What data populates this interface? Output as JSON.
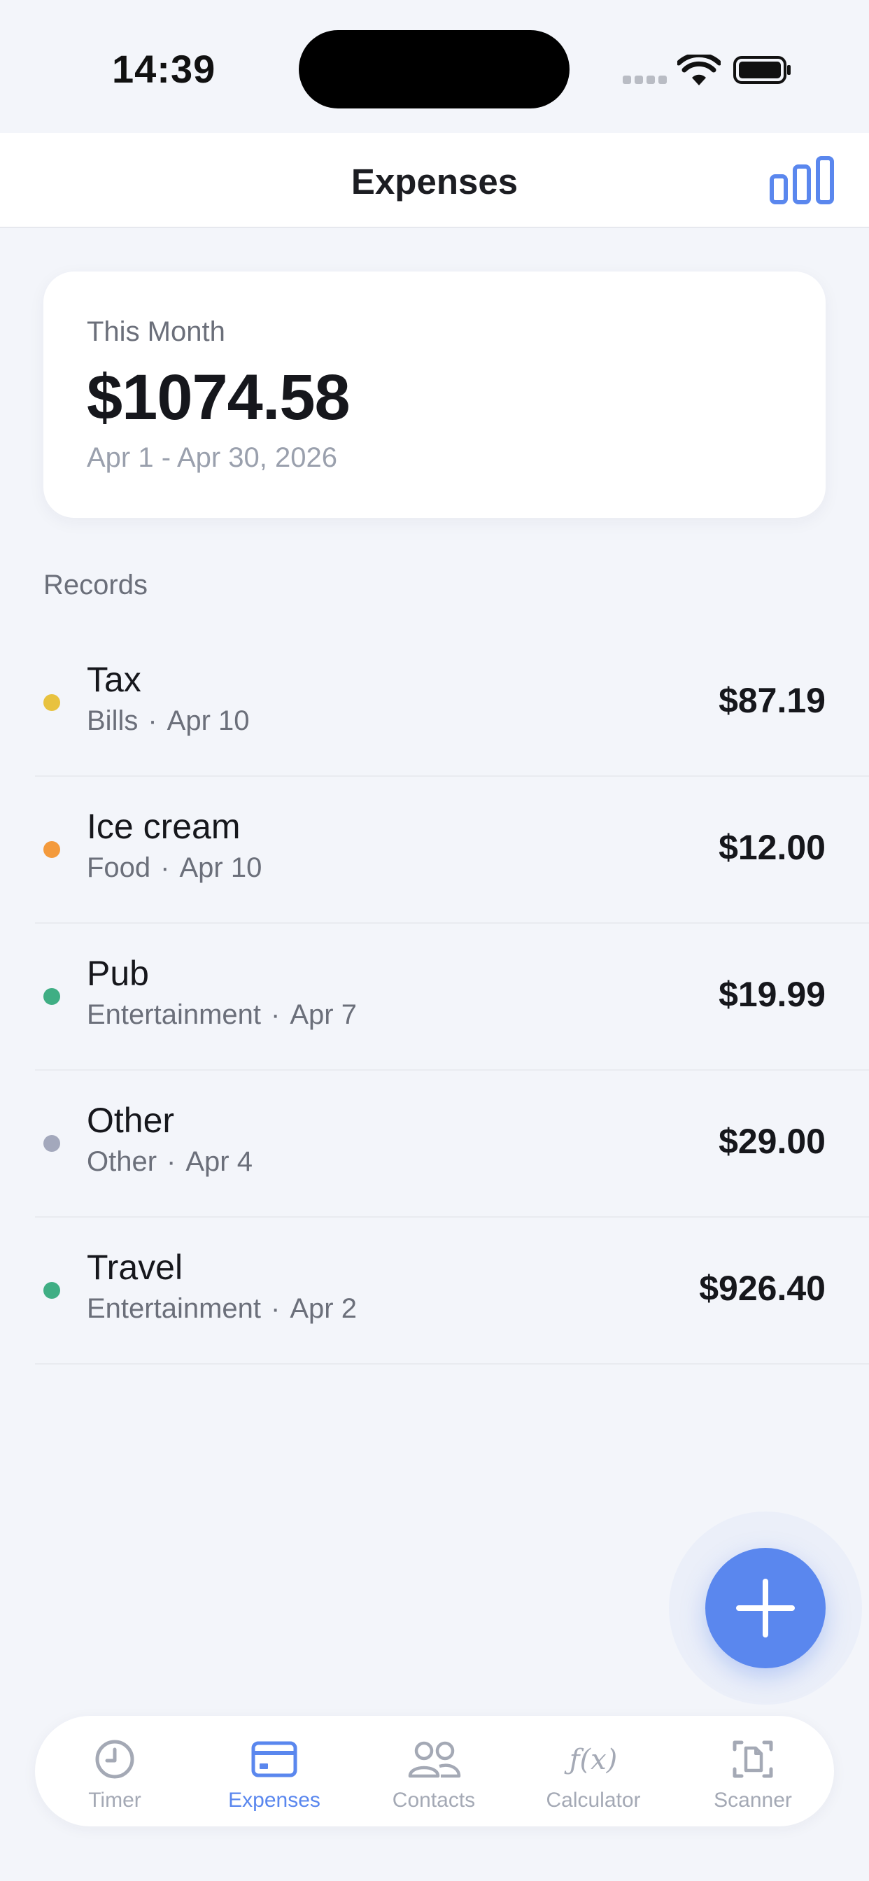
{
  "status_bar": {
    "time": "14:39"
  },
  "header": {
    "title": "Expenses"
  },
  "summary": {
    "label": "This Month",
    "amount": "$1074.58",
    "range": "Apr 1 - Apr 30, 2026"
  },
  "records": {
    "section_title": "Records",
    "items": [
      {
        "title": "Tax",
        "category": "Bills",
        "date": "Apr 10",
        "amount": "$87.19",
        "color": "#e8c23f"
      },
      {
        "title": "Ice cream",
        "category": "Food",
        "date": "Apr 10",
        "amount": "$12.00",
        "color": "#f39a3c"
      },
      {
        "title": "Pub",
        "category": "Entertainment",
        "date": "Apr 7",
        "amount": "$19.99",
        "color": "#3fae84"
      },
      {
        "title": "Other",
        "category": "Other",
        "date": "Apr 4",
        "amount": "$29.00",
        "color": "#a3a8bc"
      },
      {
        "title": "Travel",
        "category": "Entertainment",
        "date": "Apr 2",
        "amount": "$926.40",
        "color": "#3fae84"
      }
    ],
    "separator": "·"
  },
  "tabs": [
    {
      "label": "Timer",
      "icon": "clock-icon",
      "active": false
    },
    {
      "label": "Expenses",
      "icon": "card-icon",
      "active": true
    },
    {
      "label": "Contacts",
      "icon": "people-icon",
      "active": false
    },
    {
      "label": "Calculator",
      "icon": "function-icon",
      "active": false
    },
    {
      "label": "Scanner",
      "icon": "scan-document-icon",
      "active": false
    }
  ],
  "colors": {
    "accent": "#5a87ee",
    "tab_inactive": "#a4a9b5"
  }
}
